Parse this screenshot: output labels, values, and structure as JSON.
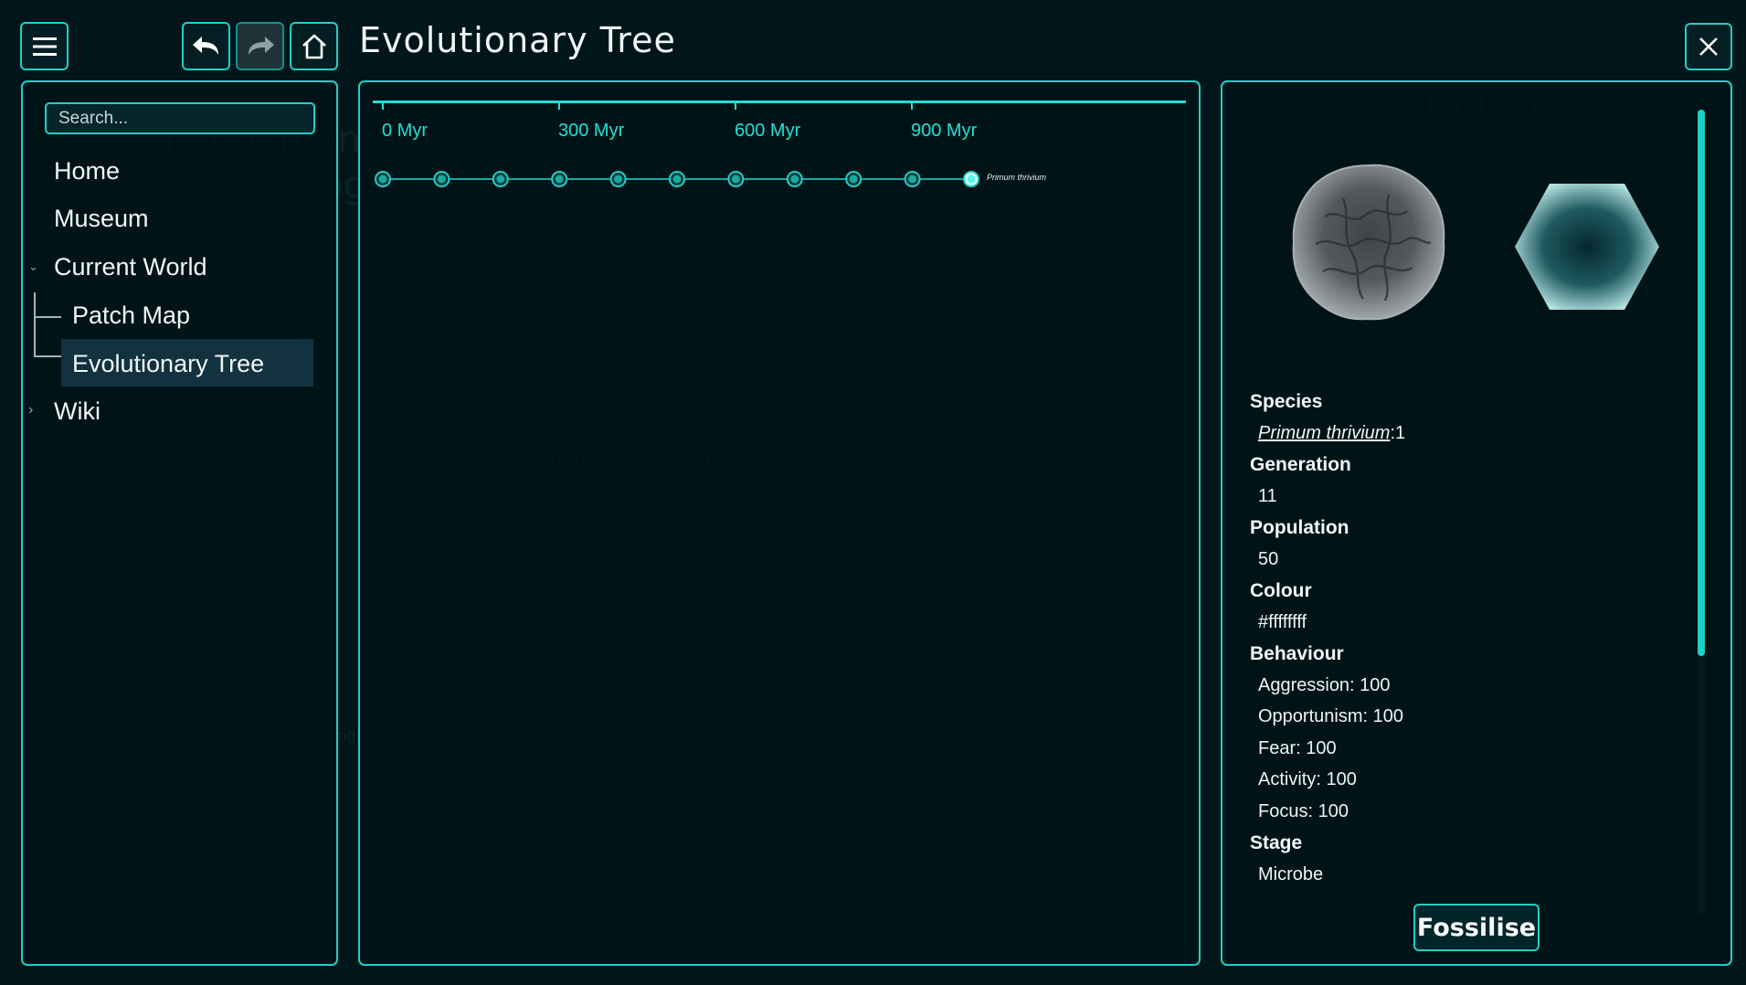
{
  "window": {
    "title": "Evolutionary Tree"
  },
  "toolbar": {
    "menu_icon": "hamburger-menu-icon",
    "back_icon": "undo-arrow-icon",
    "forward_icon": "redo-arrow-icon",
    "home_icon": "home-icon",
    "close_icon": "close-icon"
  },
  "sidebar": {
    "search_placeholder": "Search...",
    "items": [
      {
        "label": "Home"
      },
      {
        "label": "Museum"
      },
      {
        "label": "Current World"
      },
      {
        "label": "Patch Map"
      },
      {
        "label": "Evolutionary Tree"
      },
      {
        "label": "Wiki"
      }
    ],
    "selected": "Evolutionary Tree"
  },
  "timeline": {
    "ticks": [
      "0 Myr",
      "300 Myr",
      "600 Myr",
      "900 Myr"
    ],
    "node_count": 11,
    "selected_node_label": "Primum thrivium"
  },
  "species_info": {
    "species_label": "Species",
    "species_name": "Primum thrivium",
    "species_suffix": ":1",
    "generation_label": "Generation",
    "generation": "11",
    "population_label": "Population",
    "population": "50",
    "colour_label": "Colour",
    "colour": "#ffffffff",
    "behaviour_label": "Behaviour",
    "behaviour": [
      "Aggression: 100",
      "Opportunism: 100",
      "Fear: 100",
      "Activity: 100",
      "Focus: 100"
    ],
    "stage_label": "Stage",
    "stage": "Microbe"
  },
  "actions": {
    "fossilise_label": "Fossilise"
  },
  "colors": {
    "accent": "#1fd0c4",
    "background": "#01161a",
    "selection": "#123240"
  }
}
